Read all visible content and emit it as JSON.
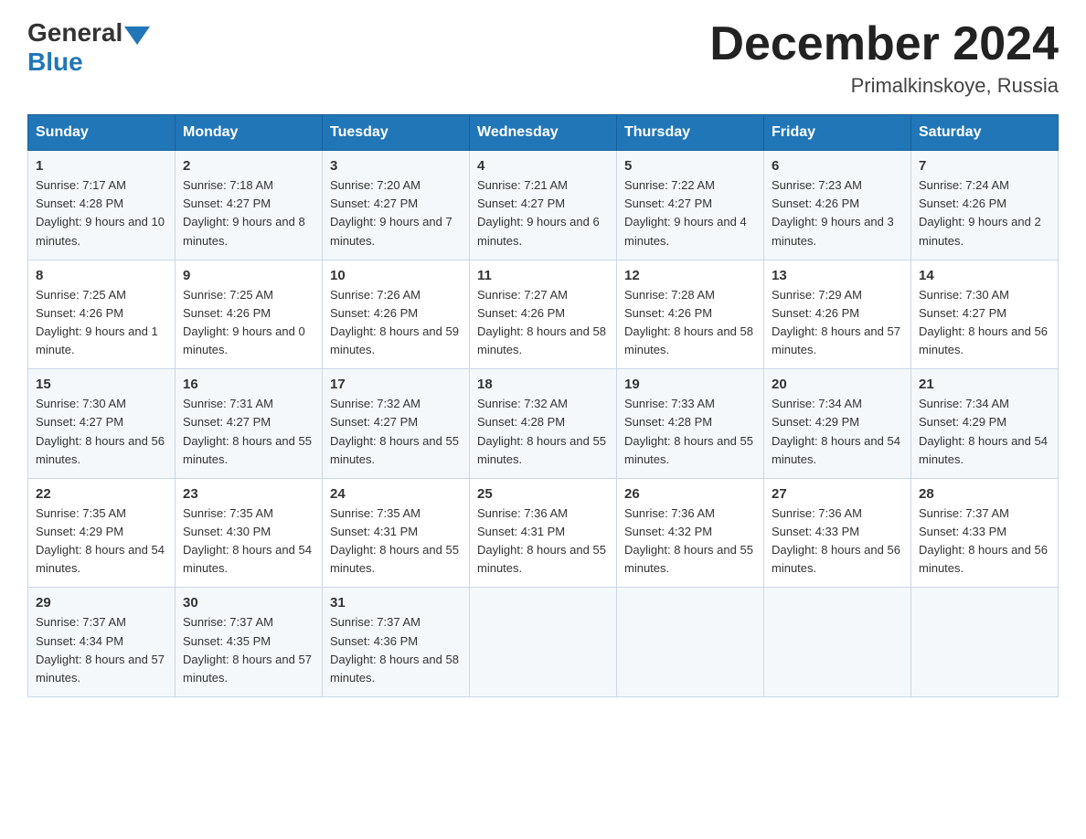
{
  "logo": {
    "general": "General",
    "blue": "Blue"
  },
  "title": "December 2024",
  "location": "Primalkinskoye, Russia",
  "days_of_week": [
    "Sunday",
    "Monday",
    "Tuesday",
    "Wednesday",
    "Thursday",
    "Friday",
    "Saturday"
  ],
  "weeks": [
    [
      {
        "day": "1",
        "sunrise": "7:17 AM",
        "sunset": "4:28 PM",
        "daylight": "9 hours and 10 minutes."
      },
      {
        "day": "2",
        "sunrise": "7:18 AM",
        "sunset": "4:27 PM",
        "daylight": "9 hours and 8 minutes."
      },
      {
        "day": "3",
        "sunrise": "7:20 AM",
        "sunset": "4:27 PM",
        "daylight": "9 hours and 7 minutes."
      },
      {
        "day": "4",
        "sunrise": "7:21 AM",
        "sunset": "4:27 PM",
        "daylight": "9 hours and 6 minutes."
      },
      {
        "day": "5",
        "sunrise": "7:22 AM",
        "sunset": "4:27 PM",
        "daylight": "9 hours and 4 minutes."
      },
      {
        "day": "6",
        "sunrise": "7:23 AM",
        "sunset": "4:26 PM",
        "daylight": "9 hours and 3 minutes."
      },
      {
        "day": "7",
        "sunrise": "7:24 AM",
        "sunset": "4:26 PM",
        "daylight": "9 hours and 2 minutes."
      }
    ],
    [
      {
        "day": "8",
        "sunrise": "7:25 AM",
        "sunset": "4:26 PM",
        "daylight": "9 hours and 1 minute."
      },
      {
        "day": "9",
        "sunrise": "7:25 AM",
        "sunset": "4:26 PM",
        "daylight": "9 hours and 0 minutes."
      },
      {
        "day": "10",
        "sunrise": "7:26 AM",
        "sunset": "4:26 PM",
        "daylight": "8 hours and 59 minutes."
      },
      {
        "day": "11",
        "sunrise": "7:27 AM",
        "sunset": "4:26 PM",
        "daylight": "8 hours and 58 minutes."
      },
      {
        "day": "12",
        "sunrise": "7:28 AM",
        "sunset": "4:26 PM",
        "daylight": "8 hours and 58 minutes."
      },
      {
        "day": "13",
        "sunrise": "7:29 AM",
        "sunset": "4:26 PM",
        "daylight": "8 hours and 57 minutes."
      },
      {
        "day": "14",
        "sunrise": "7:30 AM",
        "sunset": "4:27 PM",
        "daylight": "8 hours and 56 minutes."
      }
    ],
    [
      {
        "day": "15",
        "sunrise": "7:30 AM",
        "sunset": "4:27 PM",
        "daylight": "8 hours and 56 minutes."
      },
      {
        "day": "16",
        "sunrise": "7:31 AM",
        "sunset": "4:27 PM",
        "daylight": "8 hours and 55 minutes."
      },
      {
        "day": "17",
        "sunrise": "7:32 AM",
        "sunset": "4:27 PM",
        "daylight": "8 hours and 55 minutes."
      },
      {
        "day": "18",
        "sunrise": "7:32 AM",
        "sunset": "4:28 PM",
        "daylight": "8 hours and 55 minutes."
      },
      {
        "day": "19",
        "sunrise": "7:33 AM",
        "sunset": "4:28 PM",
        "daylight": "8 hours and 55 minutes."
      },
      {
        "day": "20",
        "sunrise": "7:34 AM",
        "sunset": "4:29 PM",
        "daylight": "8 hours and 54 minutes."
      },
      {
        "day": "21",
        "sunrise": "7:34 AM",
        "sunset": "4:29 PM",
        "daylight": "8 hours and 54 minutes."
      }
    ],
    [
      {
        "day": "22",
        "sunrise": "7:35 AM",
        "sunset": "4:29 PM",
        "daylight": "8 hours and 54 minutes."
      },
      {
        "day": "23",
        "sunrise": "7:35 AM",
        "sunset": "4:30 PM",
        "daylight": "8 hours and 54 minutes."
      },
      {
        "day": "24",
        "sunrise": "7:35 AM",
        "sunset": "4:31 PM",
        "daylight": "8 hours and 55 minutes."
      },
      {
        "day": "25",
        "sunrise": "7:36 AM",
        "sunset": "4:31 PM",
        "daylight": "8 hours and 55 minutes."
      },
      {
        "day": "26",
        "sunrise": "7:36 AM",
        "sunset": "4:32 PM",
        "daylight": "8 hours and 55 minutes."
      },
      {
        "day": "27",
        "sunrise": "7:36 AM",
        "sunset": "4:33 PM",
        "daylight": "8 hours and 56 minutes."
      },
      {
        "day": "28",
        "sunrise": "7:37 AM",
        "sunset": "4:33 PM",
        "daylight": "8 hours and 56 minutes."
      }
    ],
    [
      {
        "day": "29",
        "sunrise": "7:37 AM",
        "sunset": "4:34 PM",
        "daylight": "8 hours and 57 minutes."
      },
      {
        "day": "30",
        "sunrise": "7:37 AM",
        "sunset": "4:35 PM",
        "daylight": "8 hours and 57 minutes."
      },
      {
        "day": "31",
        "sunrise": "7:37 AM",
        "sunset": "4:36 PM",
        "daylight": "8 hours and 58 minutes."
      },
      null,
      null,
      null,
      null
    ]
  ],
  "sunrise_label": "Sunrise:",
  "sunset_label": "Sunset:",
  "daylight_label": "Daylight:"
}
